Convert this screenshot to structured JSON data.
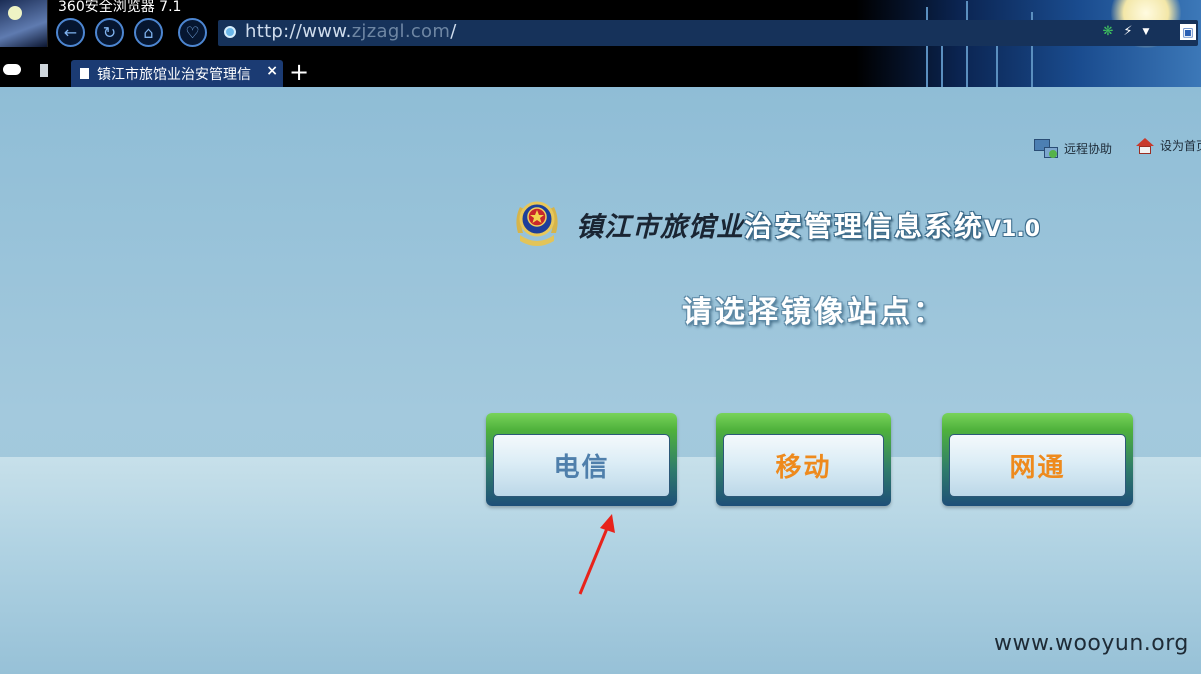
{
  "browser": {
    "app_title": "360安全浏览器 7.1",
    "url": {
      "prefix": "http://www.",
      "host": "zjzagl.com",
      "suffix": "/"
    },
    "tab": {
      "title": "镇江市旅馆业治安管理信",
      "close_glyph": "×"
    },
    "new_tab_glyph": "+"
  },
  "header_links": {
    "remote_help": "远程协助",
    "set_home": "设为首页"
  },
  "system": {
    "title_calligraphy": "镇江市旅馆业",
    "title_main": "治安管理信息系统",
    "version": "V1.0"
  },
  "prompt": "请选择镜像站点：",
  "mirrors": [
    {
      "label": "电信",
      "color": "#4f7fab"
    },
    {
      "label": "移动",
      "color": "#ee8a1d"
    },
    {
      "label": "网通",
      "color": "#ee8a1d"
    }
  ],
  "watermark": "www.wooyun.org"
}
